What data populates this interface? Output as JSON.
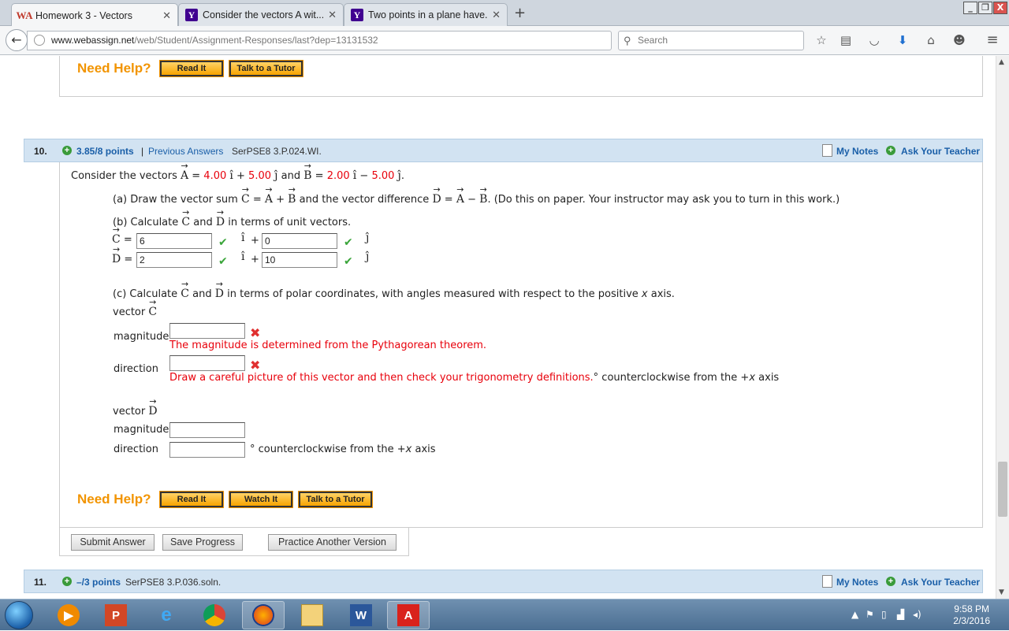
{
  "browser": {
    "tabs": [
      {
        "title": "Homework 3 - Vectors",
        "favicon": "webassign-icon",
        "active": true
      },
      {
        "title": "Consider the vectors A wit...",
        "favicon": "yahoo-icon",
        "active": false
      },
      {
        "title": "Two points in a plane have...",
        "favicon": "yahoo-icon",
        "active": false
      }
    ],
    "url_domain": "www.webassign.net",
    "url_path": "/web/Student/Assignment-Responses/last?dep=13131532",
    "search_placeholder": "Search",
    "win_controls": [
      "_",
      "❒",
      "X"
    ]
  },
  "prev_help": {
    "label": "Need Help?",
    "read_it": "Read It",
    "talk_tutor": "Talk to a Tutor"
  },
  "q10": {
    "number": "10.",
    "points": "3.85/8 points",
    "sep": "|",
    "prev_answers": "Previous Answers",
    "source": "SerPSE8 3.P.024.WI.",
    "my_notes": "My Notes",
    "ask_teacher": "Ask Your Teacher",
    "stem": {
      "consider": "Consider the vectors",
      "A_x": "4.00",
      "A_y": "5.00",
      "B_x": "2.00",
      "B_y": "5.00",
      "and": "and"
    },
    "part_a": {
      "pre": "(a) Draw the vector sum",
      "mid": "and the vector difference",
      "post": ". (Do this on paper. Your instructor may ask you to turn in this work.)"
    },
    "part_b": {
      "pre": "(b) Calculate",
      "mid": "and",
      "post": "in terms of unit vectors.",
      "C_i": "6",
      "C_j": "0",
      "D_i": "2",
      "D_j": "10"
    },
    "part_c": {
      "pre": "(c) Calculate",
      "mid": "and",
      "post": "in terms of polar coordinates, with angles measured with respect to the positive",
      "axis_var": "x",
      "axis_word": "axis.",
      "vector_label": "vector",
      "magnitude_label": "magnitude",
      "direction_label": "direction",
      "C_mag_feedback": "The magnitude is determined from the Pythagorean theorem.",
      "C_dir_feedback": "Draw a careful picture of this vector and then check your trigonometry definitions.",
      "deg_suffix": "° counterclockwise from the +",
      "deg_var": "x",
      "deg_axis": " axis",
      "C_mag": "",
      "C_dir": "",
      "D_mag": "",
      "D_dir": ""
    },
    "help": {
      "label": "Need Help?",
      "read_it": "Read It",
      "watch_it": "Watch It",
      "talk_tutor": "Talk to a Tutor"
    },
    "actions": {
      "submit": "Submit Answer",
      "save": "Save Progress",
      "practice": "Practice Another Version"
    }
  },
  "q11": {
    "number": "11.",
    "points": "–/3 points",
    "source": "SerPSE8 3.P.036.soln.",
    "my_notes": "My Notes",
    "ask_teacher": "Ask Your Teacher"
  },
  "taskbar": {
    "time": "9:58 PM",
    "date": "2/3/2016",
    "apps": [
      "windows-media-player-icon",
      "powerpoint-icon",
      "internet-explorer-icon",
      "chrome-icon",
      "firefox-icon",
      "file-explorer-icon",
      "word-icon",
      "acrobat-icon"
    ]
  },
  "colors": {
    "header_blue": "#d2e3f2",
    "link_blue": "#1a5fa8",
    "orange": "#f29400",
    "error_red": "#e8000b",
    "check_green": "#3aa53a"
  }
}
